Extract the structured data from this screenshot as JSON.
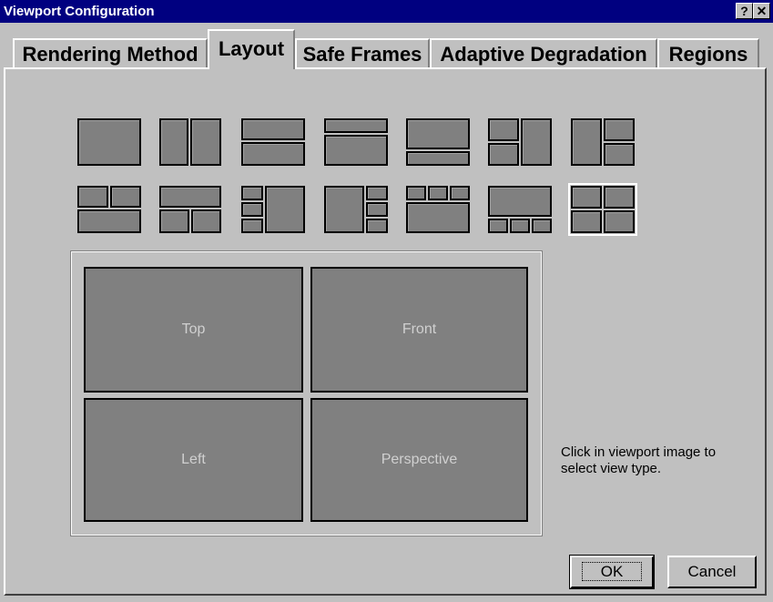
{
  "window": {
    "title": "Viewport Configuration",
    "help_label": "?",
    "close_label": "✕"
  },
  "tabs": [
    {
      "label": "Rendering Method"
    },
    {
      "label": "Layout",
      "active": true
    },
    {
      "label": "Safe Frames"
    },
    {
      "label": "Adaptive Degradation"
    },
    {
      "label": "Regions"
    }
  ],
  "layouts": {
    "selected_index": 13,
    "count": 14
  },
  "viewports": {
    "top": "Top",
    "front": "Front",
    "left": "Left",
    "perspective": "Perspective"
  },
  "hint_text": "Click in viewport image to select view type.",
  "buttons": {
    "ok": "OK",
    "cancel": "Cancel"
  }
}
